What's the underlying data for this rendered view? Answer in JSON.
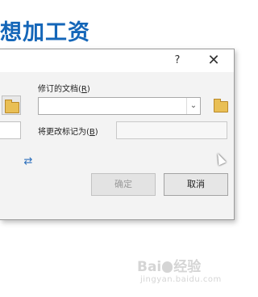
{
  "slide": {
    "title": "想加工资"
  },
  "dialog": {
    "help_label": "?",
    "close_label": "✕",
    "revised_doc_label": "修订的文档(",
    "revised_doc_hotkey": "R",
    "revised_doc_close": ")",
    "revised_doc_value": "",
    "mark_changes_label": "将更改标记为(",
    "mark_changes_hotkey": "B",
    "mark_changes_close": ")",
    "mark_changes_value": "",
    "swap_icon": "⇄",
    "ok_label": "确定",
    "cancel_label": "取消"
  },
  "watermark": {
    "brand_a": "Bai",
    "brand_b": "经验",
    "url": "jingyan.baidu.com"
  }
}
